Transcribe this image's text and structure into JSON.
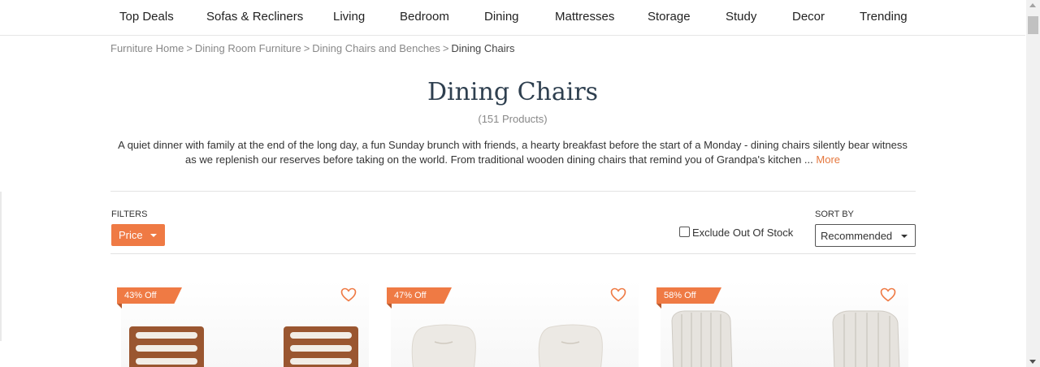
{
  "nav": {
    "items": [
      "Top Deals",
      "Sofas & Recliners",
      "Living",
      "Bedroom",
      "Dining",
      "Mattresses",
      "Storage",
      "Study",
      "Decor",
      "Trending"
    ]
  },
  "breadcrumb": {
    "items": [
      "Furniture Home",
      "Dining Room Furniture",
      "Dining Chairs and Benches"
    ],
    "current": "Dining Chairs",
    "separator": ">"
  },
  "page": {
    "title": "Dining Chairs",
    "count": "(151 Products)",
    "description": "A quiet dinner with family at the end of the long day, a fun Sunday brunch with friends, a hearty breakfast before the start of a Monday - dining chairs silently bear witness as we replenish our reserves before taking on the world. From traditional wooden dining chairs that remind you of Grandpa's kitchen ...",
    "more_label": "More"
  },
  "filters": {
    "label": "FILTERS",
    "price_label": "Price",
    "exclude_label": "Exclude Out Of Stock",
    "exclude_checked": false
  },
  "sort": {
    "label": "SORT BY",
    "selected": "Recommended"
  },
  "products": [
    {
      "badge": "43% Off",
      "image": "wooden-dining-chairs",
      "icon": "heart-icon"
    },
    {
      "badge": "47% Off",
      "image": "white-upholstered-chairs",
      "icon": "heart-icon"
    },
    {
      "badge": "58% Off",
      "image": "channel-tufted-chairs",
      "icon": "heart-icon"
    }
  ],
  "colors": {
    "accent": "#ef7a44",
    "title": "#2e3f4f",
    "muted": "#888888"
  }
}
